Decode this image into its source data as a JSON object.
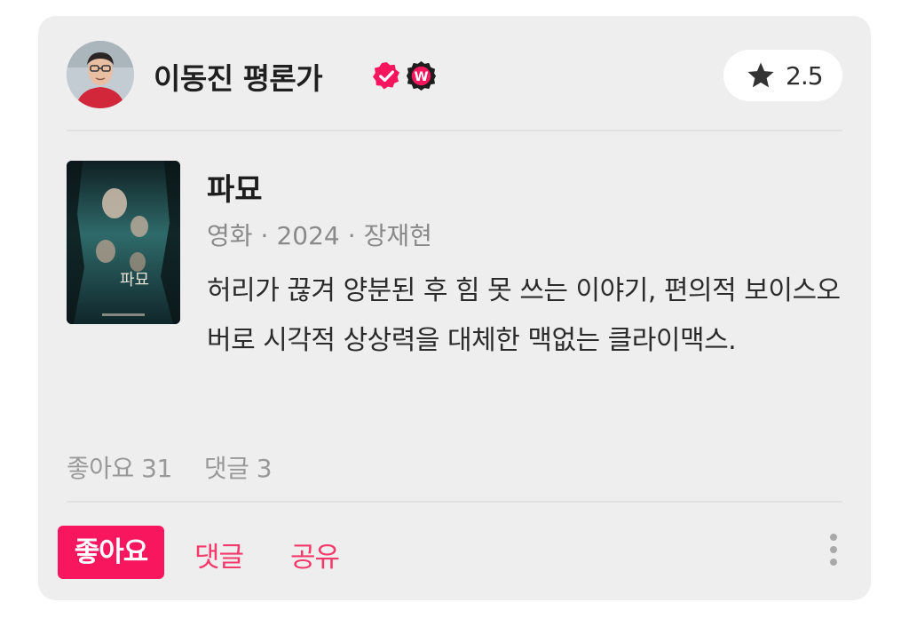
{
  "author": {
    "name": "이동진 평론가",
    "verified_icon": "verified-check-icon",
    "badge_icon": "w-badge-icon",
    "badge_letter": "W",
    "accent_color": "#f8175e"
  },
  "rating": {
    "icon": "star-icon",
    "value": "2.5"
  },
  "movie": {
    "title": "파묘",
    "category": "영화",
    "year": "2024",
    "director": "장재현",
    "separator": "·",
    "poster_title": "파묘"
  },
  "review": {
    "text": "허리가 끊겨 양분된 후 힘 못 쓰는 이야기, 편의적 보이스오버로 시각적 상상력을 대체한 맥없는 클라이맥스."
  },
  "stats": {
    "likes": "좋아요 31",
    "comments": "댓글 3"
  },
  "actions": {
    "like": "좋아요",
    "comment": "댓글",
    "share": "공유",
    "more_icon": "more-vertical-icon"
  }
}
